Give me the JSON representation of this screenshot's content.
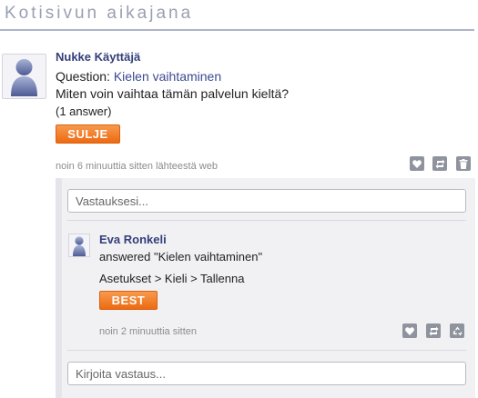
{
  "page": {
    "title": "Kotisivun aikajana"
  },
  "post": {
    "author": "Nukke Käyttäjä",
    "question_prefix": "Question: ",
    "question_title": "Kielen vaihtaminen",
    "question_body": "Miten voin vaihtaa tämän palvelun kieltä?",
    "answer_count": "(1 answer)",
    "close_label": "SULJE",
    "meta": "noin 6 minuuttia sitten lähteestä web",
    "icons": [
      "heart-icon",
      "repost-icon",
      "trash-icon"
    ]
  },
  "thread": {
    "reply_placeholder": "Vastauksesi...",
    "answer": {
      "author": "Eva Ronkeli",
      "action_text": "answered \"Kielen vaihtaminen\"",
      "body": "Asetukset > Kieli > Tallenna",
      "best_label": "BEST",
      "meta": "noin 2 minuuttia sitten",
      "icons": [
        "heart-icon",
        "repost-icon",
        "recycle-icon"
      ]
    },
    "comment_placeholder": "Kirjoita vastaus..."
  },
  "colors": {
    "accent": "#333f7a",
    "button_orange": "#ed6a12",
    "title_gray": "#9a9fb3",
    "icon_gray": "#8f939d"
  }
}
